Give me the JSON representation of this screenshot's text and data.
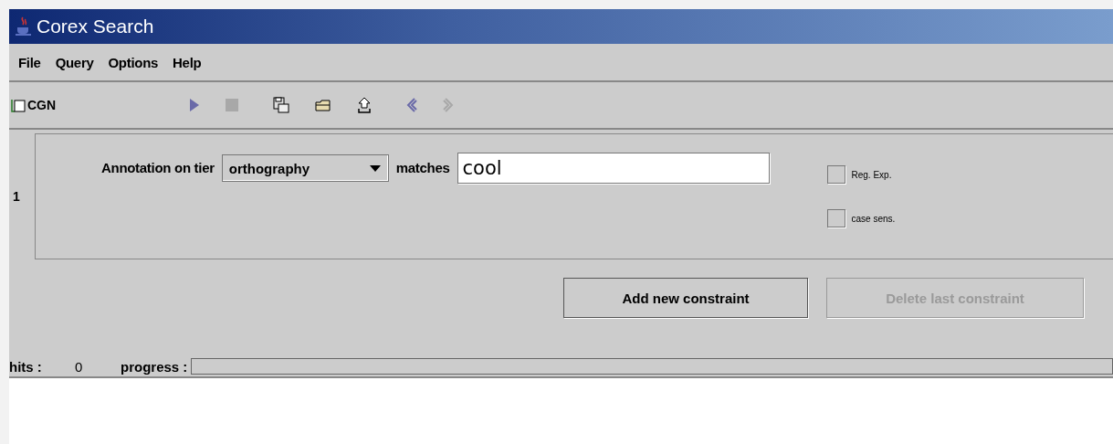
{
  "window": {
    "title": "Corex Search"
  },
  "menu": [
    "File",
    "Query",
    "Options",
    "Help"
  ],
  "toolbar": {
    "corpus": "CGN",
    "tools": [
      {
        "kind": "play",
        "disabled": false
      },
      {
        "kind": "stop",
        "disabled": true
      },
      {
        "kind": "save",
        "disabled": false
      },
      {
        "kind": "open",
        "disabled": false
      },
      {
        "kind": "export",
        "disabled": false
      },
      {
        "kind": "back",
        "disabled": false
      },
      {
        "kind": "forward",
        "disabled": true
      }
    ]
  },
  "constraints": [
    {
      "number": "1",
      "label": "Annotation on tier",
      "tier": "orthography",
      "matches_label": "matches",
      "value": "cool",
      "options": [
        {
          "label": "Reg. Exp.",
          "checked": false
        },
        {
          "label": "case sens.",
          "checked": false
        }
      ]
    }
  ],
  "buttons": [
    {
      "label": "Add new constraint",
      "disabled": false
    },
    {
      "label": "Delete last constraint",
      "disabled": true
    }
  ],
  "status": {
    "hits_label": "hits :",
    "hits": "0",
    "progress_label": "progress :",
    "level": 0
  }
}
